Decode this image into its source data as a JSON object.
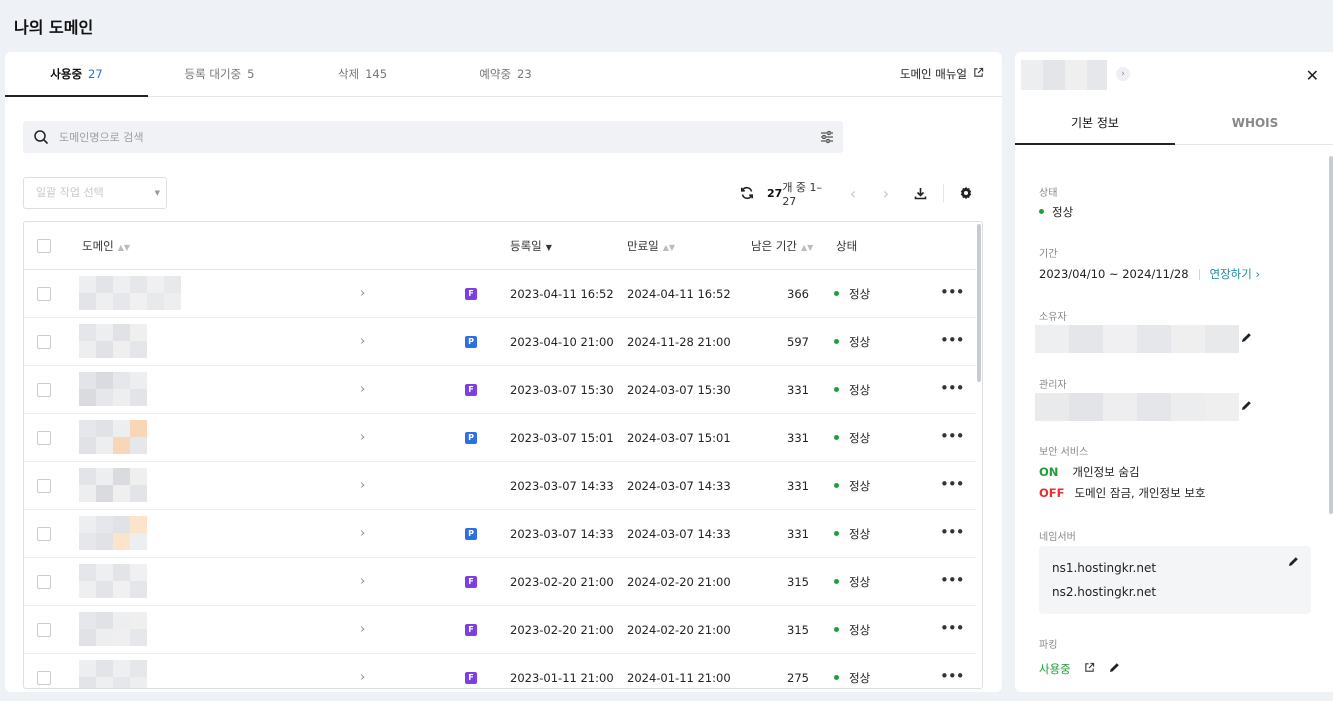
{
  "page_title": "나의 도메인",
  "tabs": [
    {
      "label": "사용중",
      "count": "27"
    },
    {
      "label": "등록 대기중",
      "count": "5"
    },
    {
      "label": "삭제",
      "count": "145"
    },
    {
      "label": "예약중",
      "count": "23"
    }
  ],
  "manual_link": "도메인 매뉴얼",
  "search": {
    "placeholder": "도메인명으로 검색"
  },
  "bulk_select": {
    "placeholder": "일괄 작업 선택"
  },
  "pagination": {
    "total": "27",
    "text": "개 중 1–27"
  },
  "table": {
    "headers": {
      "domain": "도메인",
      "registered": "등록일",
      "expires": "만료일",
      "remaining": "남은 기간",
      "status": "상태"
    },
    "rows": [
      {
        "badge": "F",
        "registered": "2023-04-11 16:52",
        "expires": "2024-04-11 16:52",
        "remaining": "366",
        "status": "정상"
      },
      {
        "badge": "P",
        "registered": "2023-04-10 21:00",
        "expires": "2024-11-28 21:00",
        "remaining": "597",
        "status": "정상"
      },
      {
        "badge": "F",
        "registered": "2023-03-07 15:30",
        "expires": "2024-03-07 15:30",
        "remaining": "331",
        "status": "정상"
      },
      {
        "badge": "P",
        "registered": "2023-03-07 15:01",
        "expires": "2024-03-07 15:01",
        "remaining": "331",
        "status": "정상"
      },
      {
        "badge": "",
        "registered": "2023-03-07 14:33",
        "expires": "2024-03-07 14:33",
        "remaining": "331",
        "status": "정상"
      },
      {
        "badge": "P",
        "registered": "2023-03-07 14:33",
        "expires": "2024-03-07 14:33",
        "remaining": "331",
        "status": "정상"
      },
      {
        "badge": "F",
        "registered": "2023-02-20 21:00",
        "expires": "2024-02-20 21:00",
        "remaining": "315",
        "status": "정상"
      },
      {
        "badge": "F",
        "registered": "2023-02-20 21:00",
        "expires": "2024-02-20 21:00",
        "remaining": "315",
        "status": "정상"
      },
      {
        "badge": "F",
        "registered": "2023-01-11 21:00",
        "expires": "2024-01-11 21:00",
        "remaining": "275",
        "status": "정상"
      }
    ]
  },
  "side": {
    "tabs": [
      "기본 정보",
      "WHOIS"
    ],
    "status_label": "상태",
    "status_value": "정상",
    "period_label": "기간",
    "period_value": "2023/04/10 ~ 2024/11/28",
    "extend_link": "연장하기",
    "owner_label": "소유자",
    "admin_label": "관리자",
    "security_label": "보안 서비스",
    "security_on": {
      "tag": "ON",
      "text": "개인정보 숨김"
    },
    "security_off": {
      "tag": "OFF",
      "text": "도메인 잠금, 개인정보 보호"
    },
    "nameserver_label": "네임서버",
    "nameservers": [
      "ns1.hostingkr.net",
      "ns2.hostingkr.net"
    ],
    "parking_label": "파킹",
    "parking_value": "사용중"
  },
  "colors": {
    "accent_blue": "#2f6fe0",
    "status_green": "#1f9d3a",
    "off_red": "#e03131",
    "badge_F": "#7b3fe4",
    "badge_P": "#2f6fe0",
    "link_teal": "#1a8a9e"
  }
}
